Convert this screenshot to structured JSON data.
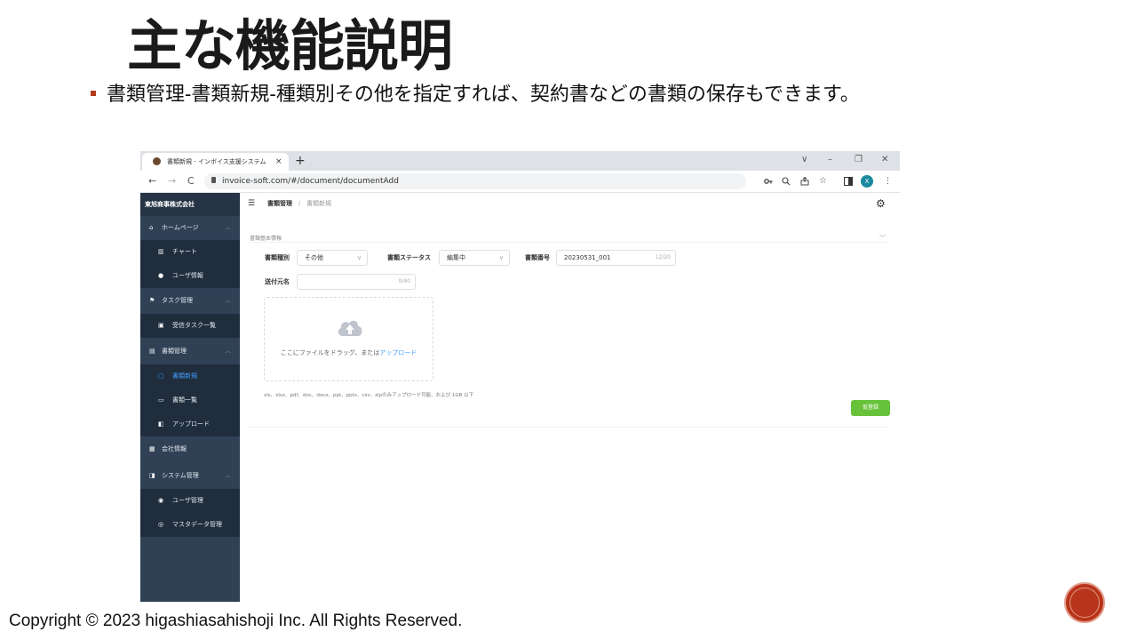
{
  "slide": {
    "title": "主な機能説明",
    "bullet": "書類管理-書類新規-種類別その他を指定すれば、契約書などの書類の保存もできます。",
    "copyright": "Copyright © 2023 higashiasahishoji Inc. All Rights Reserved."
  },
  "browser": {
    "tab_title": "書類新規 - インボイス支援システム",
    "tab_close": "×",
    "new_tab": "+",
    "window_controls": [
      "∨",
      "–",
      "❐",
      "✕"
    ],
    "nav": [
      "←",
      "→",
      "C"
    ],
    "url": "invoice-soft.com/#/document/documentAdd",
    "toolbar_icons": [
      "key-icon",
      "zoom-icon",
      "share-icon",
      "star-icon",
      "sidepanel-icon",
      "profile-icon",
      "menu-icon"
    ],
    "profile_initial": "X",
    "menu_glyph": "⋮"
  },
  "sidebar": {
    "company": "東旭商事株式会社",
    "items": [
      {
        "label": "ホームページ",
        "icon": "home-icon",
        "sub": false
      },
      {
        "label": "チャート",
        "icon": "chart-icon",
        "sub": true
      },
      {
        "label": "ユーザ情報",
        "icon": "user-icon",
        "sub": true
      },
      {
        "label": "タスク管理",
        "icon": "flag-icon",
        "sub": false
      },
      {
        "label": "受信タスク一覧",
        "icon": "clipboard-icon",
        "sub": true
      },
      {
        "label": "書類管理",
        "icon": "document-icon",
        "sub": false
      },
      {
        "label": "書類新規",
        "icon": "new-document-icon",
        "sub": true,
        "active": true
      },
      {
        "label": "書類一覧",
        "icon": "folder-icon",
        "sub": true
      },
      {
        "label": "アップロード",
        "icon": "upload-icon",
        "sub": true
      },
      {
        "label": "会社情報",
        "icon": "building-icon",
        "sub": false
      },
      {
        "label": "システム管理",
        "icon": "system-icon",
        "sub": false
      },
      {
        "label": "ユーザ管理",
        "icon": "users-icon",
        "sub": true
      },
      {
        "label": "マスタデータ管理",
        "icon": "database-icon",
        "sub": true
      }
    ]
  },
  "header": {
    "breadcrumb_parent": "書類管理",
    "breadcrumb_sep": "/",
    "breadcrumb_current": "書類新規"
  },
  "form": {
    "section_title": "書類基本情報",
    "type_label": "書類種別",
    "type_value": "その他",
    "status_label": "書類ステータス",
    "status_value": "編集中",
    "number_label": "書類番号",
    "number_value": "20230531_001",
    "number_count": "12/20",
    "sender_label": "送付元名",
    "sender_value": "",
    "sender_count": "0/40",
    "upload_text": "ここにファイルをドラッグ、または",
    "upload_link": "アップロード",
    "hint": "xls、xlsx、pdf、doc、docx、ppt、pptx、csv、zipのみアップロード可能、および 1GB 以下",
    "submit_label": "仮登録"
  },
  "colors": {
    "sidebar_bg": "#304156",
    "active": "#409eff",
    "submit": "#67c23a",
    "bullet": "#b33a1a"
  }
}
